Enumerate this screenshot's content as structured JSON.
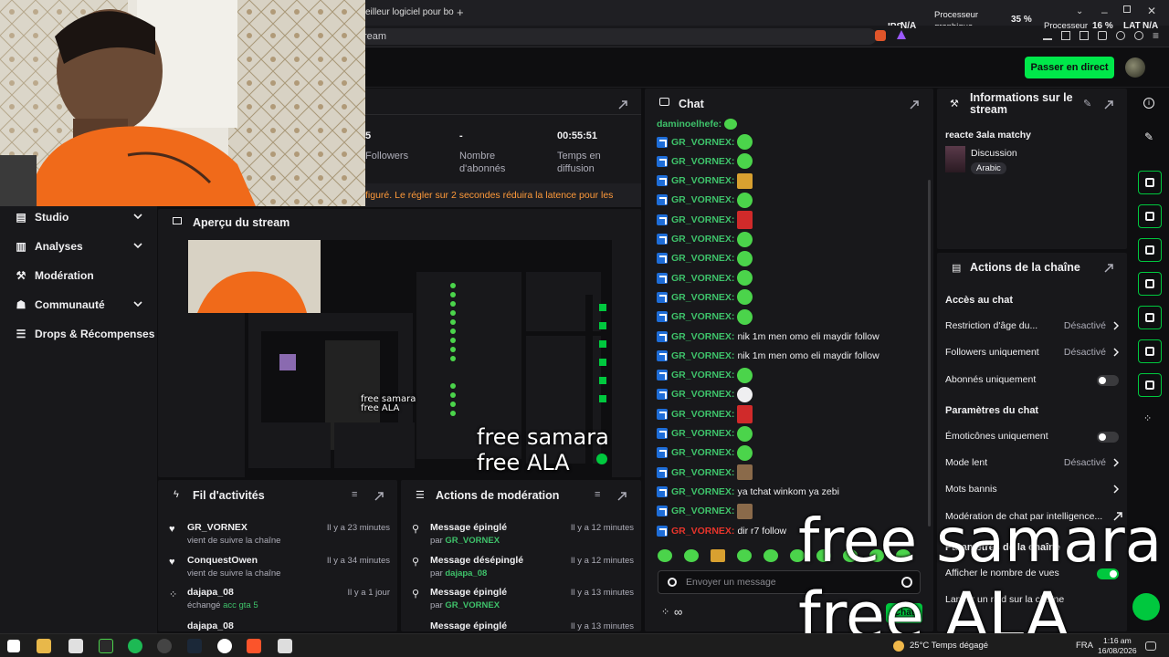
{
  "browser": {
    "tab_title": "eilleur logiciel pour bo",
    "url_text": "ream",
    "fps_label": "IPS",
    "fps_value": "N/A",
    "gpu_label": "Processeur graphique",
    "gpu_pct": "35 %",
    "cpu_label": "Processeur",
    "cpu_pct": "16 %",
    "lat_label": "LAT",
    "lat_value": "N/A"
  },
  "header": {
    "go_live_label": "Passer en direct"
  },
  "sidebar": {
    "items": [
      {
        "label": "Studio",
        "icon": "studio-icon",
        "has_chevron": true
      },
      {
        "label": "Analyses",
        "icon": "analytics-icon",
        "has_chevron": true
      },
      {
        "label": "Modération",
        "icon": "wrench-icon",
        "has_chevron": false
      },
      {
        "label": "Communauté",
        "icon": "community-icon",
        "has_chevron": true
      },
      {
        "label": "Drops & Récompenses",
        "icon": "list-icon",
        "has_chevron": false
      }
    ]
  },
  "stats": {
    "followers_value": "5",
    "followers_label": "Followers",
    "subs_value": "-",
    "subs_label": "Nombre d'abonnés",
    "time_value": "00:55:51",
    "time_label": "Temps en diffusion",
    "latency_notice": "figuré. Le régler sur 2 secondes réduira la latence pour les"
  },
  "preview": {
    "title": "Aperçu du stream"
  },
  "activity": {
    "title": "Fil d'activités",
    "items": [
      {
        "name": "GR_VORNEX",
        "sub": "vient de suivre la chaîne",
        "time": "Il y a 23 minutes",
        "icon": "heart-icon"
      },
      {
        "name": "ConquestOwen",
        "sub": "vient de suivre la chaîne",
        "time": "Il y a 34 minutes",
        "icon": "heart-icon"
      },
      {
        "name": "dajapa_08",
        "sub": "échangé",
        "sub_highlight": "acc gta 5",
        "time": "Il y a 1 jour",
        "icon": "points-icon"
      },
      {
        "name": "dajapa_08",
        "sub": "",
        "time": "",
        "icon": "points-icon"
      }
    ]
  },
  "modactions": {
    "title": "Actions de modération",
    "items": [
      {
        "action": "Message épinglé",
        "by": "par",
        "user": "GR_VORNEX",
        "time": "Il y a 12 minutes"
      },
      {
        "action": "Message désépinglé",
        "by": "par",
        "user": "dajapa_08",
        "time": "Il y a 12 minutes"
      },
      {
        "action": "Message épinglé",
        "by": "par",
        "user": "GR_VORNEX",
        "time": "Il y a 13 minutes"
      },
      {
        "action": "Message épinglé",
        "by": "",
        "user": "",
        "time": "Il y a 13 minutes"
      }
    ]
  },
  "chat": {
    "title": "Chat",
    "first_user": "daminoelhefe:",
    "lines": [
      {
        "user": "GR_VORNEX:",
        "msg": "",
        "emote": "green"
      },
      {
        "user": "GR_VORNEX:",
        "msg": "",
        "emote": "green"
      },
      {
        "user": "GR_VORNEX:",
        "msg": "",
        "emote": "box"
      },
      {
        "user": "GR_VORNEX:",
        "msg": "",
        "emote": "eyes"
      },
      {
        "user": "GR_VORNEX:",
        "msg": "",
        "emote": "red"
      },
      {
        "user": "GR_VORNEX:",
        "msg": "",
        "emote": "green"
      },
      {
        "user": "GR_VORNEX:",
        "msg": "",
        "emote": "green"
      },
      {
        "user": "GR_VORNEX:",
        "msg": "",
        "emote": "eyes"
      },
      {
        "user": "GR_VORNEX:",
        "msg": "",
        "emote": "green"
      },
      {
        "user": "GR_VORNEX:",
        "msg": "",
        "emote": "eyes"
      },
      {
        "user": "GR_VORNEX:",
        "msg": "nik 1m men omo eli maydir follow",
        "emote": ""
      },
      {
        "user": "GR_VORNEX:",
        "msg": "nik 1m men omo eli maydir follow",
        "emote": ""
      },
      {
        "user": "GR_VORNEX:",
        "msg": "",
        "emote": "eyes"
      },
      {
        "user": "GR_VORNEX:",
        "msg": "",
        "emote": "white"
      },
      {
        "user": "GR_VORNEX:",
        "msg": "",
        "emote": "red"
      },
      {
        "user": "GR_VORNEX:",
        "msg": "",
        "emote": "eyes"
      },
      {
        "user": "GR_VORNEX:",
        "msg": "",
        "emote": "green"
      },
      {
        "user": "GR_VORNEX:",
        "msg": "",
        "emote": "photo"
      },
      {
        "user": "GR_VORNEX:",
        "msg": "ya tchat winkom ya zebi",
        "emote": ""
      },
      {
        "user": "GR_VORNEX:",
        "msg": "",
        "emote": "photo"
      },
      {
        "user": "GR_VORNEX:",
        "msg": "dir r7 follow",
        "emote": "",
        "red": true
      }
    ],
    "input_placeholder": "Envoyer un message",
    "send_label": "Chat"
  },
  "streaminfo": {
    "title": "Informations sur le stream",
    "stream_title": "reacte 3ala matchy",
    "category": "Discussion",
    "tag": "Arabic"
  },
  "channelactions": {
    "title": "Actions de la chaîne",
    "section1": "Accès au chat",
    "age_restriction": "Restriction d'âge du...",
    "age_value": "Désactivé",
    "followers_only": "Followers uniquement",
    "followers_value": "Désactivé",
    "subs_only": "Abonnés uniquement",
    "section2": "Paramètres du chat",
    "emotes_only": "Émoticônes uniquement",
    "slow_mode": "Mode lent",
    "slow_value": "Désactivé",
    "banned_words": "Mots bannis",
    "ai_mod": "Modération de chat par intelligence...",
    "section3": "Paramètres de la chaîne",
    "show_views": "Afficher le nombre de vues",
    "raid": "Lancer un raid sur la chaîne"
  },
  "overlay": {
    "line1": "free samara",
    "line2": "free ALA"
  },
  "taskbar": {
    "weather": "25°C  Temps dégagé",
    "lang": "FRA",
    "time": "1:16 am",
    "date": "16/08/2026"
  },
  "colors": {
    "accent": "#00e84a",
    "chat_user": "#3ec26a",
    "chat_user_red": "#e8342b",
    "bg": "#0e0e10",
    "panel": "#18181b"
  }
}
